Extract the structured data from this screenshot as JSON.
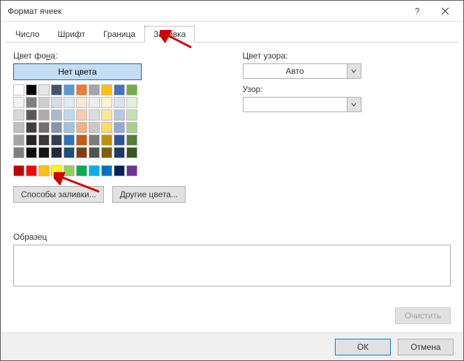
{
  "dialog": {
    "title": "Формат ячеек"
  },
  "tabs": {
    "number": "Число",
    "font": "Шрифт",
    "border": "Граница",
    "fill": "Заливка"
  },
  "left": {
    "bg_label_prefix": "Цвет фо",
    "bg_label_u": "н",
    "bg_label_suffix": "а:",
    "no_color": "Нет цвета",
    "fill_effects": "Способы заливки...",
    "more_colors": "Другие цвета..."
  },
  "right": {
    "pattern_color_label": "Цвет узора:",
    "auto": "Авто",
    "pattern_label": "Узор:"
  },
  "sample": {
    "label": "Образец"
  },
  "footer": {
    "clear": "Очистить",
    "ok": "ОК",
    "cancel": "Отмена"
  },
  "palette": {
    "row1": [
      "#ffffff",
      "#000000",
      "#e7e6e6",
      "#44546a",
      "#5b9bd5",
      "#ed7d31",
      "#a5a5a5",
      "#ffc000",
      "#4472c4",
      "#70ad47"
    ],
    "row2": [
      "#f2f2f2",
      "#7f7f7f",
      "#d0cece",
      "#d6dce4",
      "#deebf6",
      "#fbe5d5",
      "#ededed",
      "#fff2cc",
      "#d9e2f3",
      "#e2efd9"
    ],
    "row3": [
      "#d8d8d8",
      "#595959",
      "#aeabab",
      "#adb9ca",
      "#bdd7ee",
      "#f7cbac",
      "#dbdbdb",
      "#fee599",
      "#b4c6e7",
      "#c5e0b3"
    ],
    "row4": [
      "#bfbfbf",
      "#3f3f3f",
      "#757070",
      "#8496b0",
      "#9cc3e5",
      "#f4b183",
      "#c9c9c9",
      "#ffd965",
      "#8eaadb",
      "#a8d08d"
    ],
    "row5": [
      "#a5a5a5",
      "#262626",
      "#3a3838",
      "#323f4f",
      "#2e75b5",
      "#c55a11",
      "#7b7b7b",
      "#bf9000",
      "#2f5496",
      "#538135"
    ],
    "row6": [
      "#7f7f7f",
      "#0c0c0c",
      "#171616",
      "#222a35",
      "#1e4e79",
      "#833c0b",
      "#525252",
      "#7f6000",
      "#1f3864",
      "#375623"
    ],
    "standard": [
      "#c00000",
      "#ff0000",
      "#ffc000",
      "#ffff00",
      "#92d050",
      "#00b050",
      "#00b0f0",
      "#0070c0",
      "#002060",
      "#7030a0"
    ]
  }
}
